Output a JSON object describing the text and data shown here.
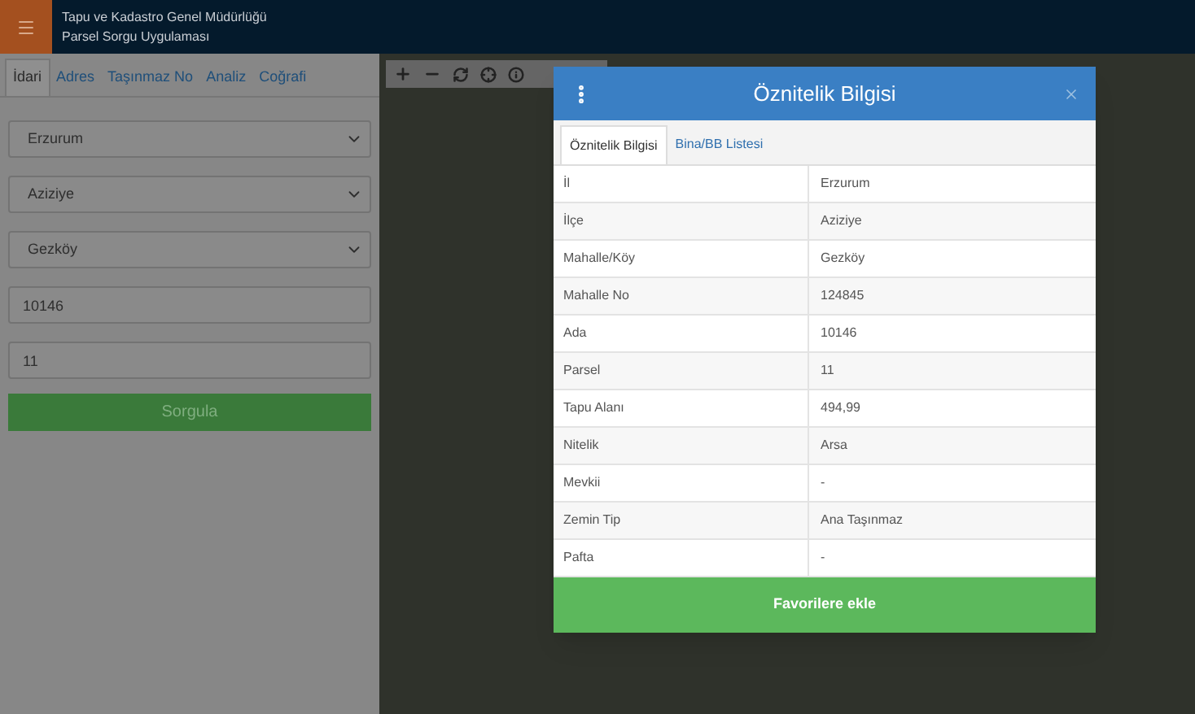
{
  "header": {
    "title": "Tapu ve Kadastro Genel Müdürlüğü",
    "subtitle": "Parsel Sorgu Uygulaması"
  },
  "sidebar": {
    "tabs": [
      {
        "label": "İdari",
        "selected": true
      },
      {
        "label": "Adres",
        "selected": false
      },
      {
        "label": "Taşınmaz No",
        "selected": false
      },
      {
        "label": "Analiz",
        "selected": false
      },
      {
        "label": "Coğrafi",
        "selected": false
      }
    ],
    "fields": [
      {
        "kind": "select",
        "value": "Erzurum"
      },
      {
        "kind": "select",
        "value": "Aziziye"
      },
      {
        "kind": "select",
        "value": "Gezköy"
      },
      {
        "kind": "input",
        "value": "10146"
      },
      {
        "kind": "input",
        "value": "11"
      }
    ],
    "button": "Sorgula"
  },
  "dialog": {
    "title": "Öznitelik Bilgisi",
    "tabs": [
      {
        "label": "Öznitelik Bilgisi",
        "selected": true
      },
      {
        "label": "Bina/BB Listesi",
        "selected": false
      }
    ],
    "rows": [
      {
        "name": "İl",
        "value": "Erzurum"
      },
      {
        "name": "İlçe",
        "value": "Aziziye"
      },
      {
        "name": "Mahalle/Köy",
        "value": "Gezköy"
      },
      {
        "name": "Mahalle No",
        "value": "124845"
      },
      {
        "name": "Ada",
        "value": "10146"
      },
      {
        "name": "Parsel",
        "value": "11"
      },
      {
        "name": "Tapu Alanı",
        "value": "494,99"
      },
      {
        "name": "Nitelik",
        "value": "Arsa"
      },
      {
        "name": "Mevkii",
        "value": "-"
      },
      {
        "name": "Zemin Tip",
        "value": "Ana Taşınmaz"
      },
      {
        "name": "Pafta",
        "value": "-"
      }
    ],
    "button": "Favorilere ekle"
  }
}
